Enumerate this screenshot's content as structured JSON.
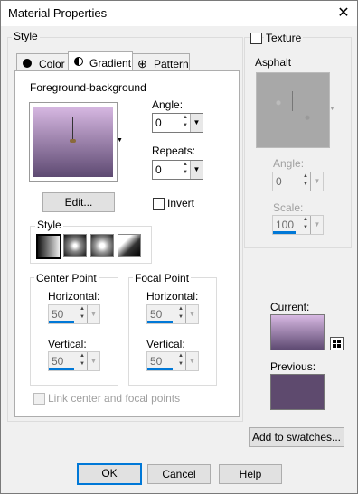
{
  "window": {
    "title": "Material Properties",
    "close_glyph": "✕"
  },
  "style_group": {
    "label": "Style",
    "tabs": [
      {
        "label": "Color"
      },
      {
        "label": "Gradient"
      },
      {
        "label": "Pattern"
      }
    ],
    "gradient_name": "Foreground-background",
    "angle_label": "Angle:",
    "angle_value": "0",
    "repeats_label": "Repeats:",
    "repeats_value": "0",
    "edit_label": "Edit...",
    "invert_label": "Invert",
    "style_label": "Style",
    "center_point": {
      "label": "Center Point",
      "h_label": "Horizontal:",
      "h_value": "50",
      "v_label": "Vertical:",
      "v_value": "50"
    },
    "focal_point": {
      "label": "Focal Point",
      "h_label": "Horizontal:",
      "h_value": "50",
      "v_label": "Vertical:",
      "v_value": "50"
    },
    "link_label": "Link center and focal points"
  },
  "texture": {
    "label": "Texture",
    "name": "Asphalt",
    "angle_label": "Angle:",
    "angle_value": "0",
    "scale_label": "Scale:",
    "scale_value": "100"
  },
  "swatches": {
    "current_label": "Current:",
    "previous_label": "Previous:",
    "add_label": "Add to swatches..."
  },
  "buttons": {
    "ok": "OK",
    "cancel": "Cancel",
    "help": "Help"
  },
  "colors": {
    "accent": "#0078d7",
    "gradient_top": "#d7b8e2",
    "gradient_bottom": "#5e4a72",
    "previous": "#5e4a6e"
  }
}
